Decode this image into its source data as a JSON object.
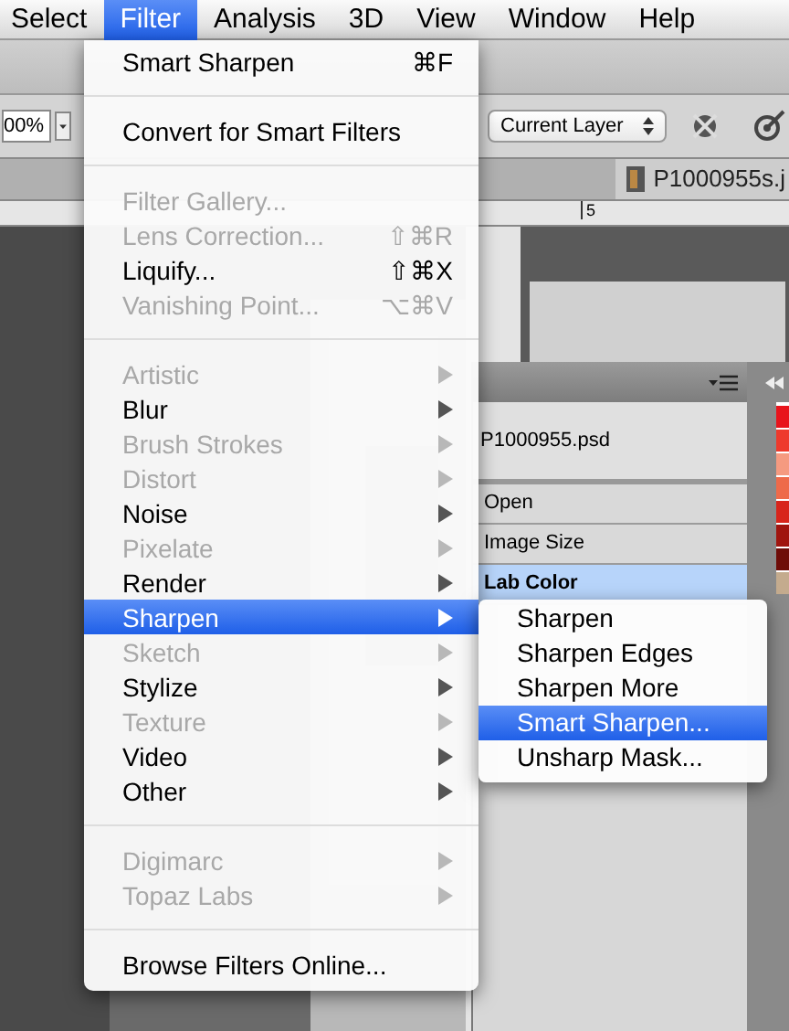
{
  "menubar": [
    {
      "label": "Select",
      "selected": false
    },
    {
      "label": "Filter",
      "selected": true
    },
    {
      "label": "Analysis",
      "selected": false
    },
    {
      "label": "3D",
      "selected": false
    },
    {
      "label": "View",
      "selected": false
    },
    {
      "label": "Window",
      "selected": false
    },
    {
      "label": "Help",
      "selected": false
    }
  ],
  "options_bar": {
    "zoom": "00%",
    "sample": "Current Layer"
  },
  "document_tab": {
    "title": "P1000955s.j"
  },
  "ruler": {
    "label": "5"
  },
  "history_panel": {
    "snapshot": "P1000955.psd",
    "steps": [
      {
        "label": "Open",
        "selected": false
      },
      {
        "label": "Image Size",
        "selected": false
      },
      {
        "label": "Lab Color",
        "selected": true
      }
    ]
  },
  "swatches": [
    {
      "color": "#e8141c"
    },
    {
      "color": "#ee3a2c"
    },
    {
      "color": "#f59a80"
    },
    {
      "color": "#ee6a4a"
    },
    {
      "color": "#d8251b"
    },
    {
      "color": "#a0150f"
    },
    {
      "color": "#6e0c08"
    },
    {
      "color": "#c4ab8e"
    }
  ],
  "filter_menu": {
    "items": [
      {
        "kind": "item",
        "label": "Smart Sharpen",
        "shortcut": "⌘F",
        "disabled": false,
        "selected": false
      },
      {
        "kind": "separator"
      },
      {
        "kind": "item",
        "label": "Convert for Smart Filters",
        "disabled": false,
        "selected": false
      },
      {
        "kind": "separator"
      },
      {
        "kind": "item",
        "label": "Filter Gallery...",
        "disabled": true,
        "selected": false
      },
      {
        "kind": "item",
        "label": "Lens Correction...",
        "shortcut": "⇧⌘R",
        "disabled": true,
        "selected": false
      },
      {
        "kind": "item",
        "label": "Liquify...",
        "shortcut": "⇧⌘X",
        "disabled": false,
        "selected": false
      },
      {
        "kind": "item",
        "label": "Vanishing Point...",
        "shortcut": "⌥⌘V",
        "disabled": true,
        "selected": false
      },
      {
        "kind": "separator"
      },
      {
        "kind": "submenu",
        "label": "Artistic",
        "disabled": true,
        "selected": false
      },
      {
        "kind": "submenu",
        "label": "Blur",
        "disabled": false,
        "selected": false
      },
      {
        "kind": "submenu",
        "label": "Brush Strokes",
        "disabled": true,
        "selected": false
      },
      {
        "kind": "submenu",
        "label": "Distort",
        "disabled": true,
        "selected": false
      },
      {
        "kind": "submenu",
        "label": "Noise",
        "disabled": false,
        "selected": false
      },
      {
        "kind": "submenu",
        "label": "Pixelate",
        "disabled": true,
        "selected": false
      },
      {
        "kind": "submenu",
        "label": "Render",
        "disabled": false,
        "selected": false
      },
      {
        "kind": "submenu",
        "label": "Sharpen",
        "disabled": false,
        "selected": true
      },
      {
        "kind": "submenu",
        "label": "Sketch",
        "disabled": true,
        "selected": false
      },
      {
        "kind": "submenu",
        "label": "Stylize",
        "disabled": false,
        "selected": false
      },
      {
        "kind": "submenu",
        "label": "Texture",
        "disabled": true,
        "selected": false
      },
      {
        "kind": "submenu",
        "label": "Video",
        "disabled": false,
        "selected": false
      },
      {
        "kind": "submenu",
        "label": "Other",
        "disabled": false,
        "selected": false
      },
      {
        "kind": "separator"
      },
      {
        "kind": "submenu",
        "label": "Digimarc",
        "disabled": true,
        "selected": false
      },
      {
        "kind": "submenu",
        "label": "Topaz Labs",
        "disabled": true,
        "selected": false
      },
      {
        "kind": "separator"
      },
      {
        "kind": "item",
        "label": "Browse Filters Online...",
        "disabled": false,
        "selected": false
      }
    ]
  },
  "sharpen_submenu": {
    "items": [
      {
        "label": "Sharpen",
        "selected": false
      },
      {
        "label": "Sharpen Edges",
        "selected": false
      },
      {
        "label": "Sharpen More",
        "selected": false
      },
      {
        "label": "Smart Sharpen...",
        "selected": true
      },
      {
        "label": "Unsharp Mask...",
        "selected": false
      }
    ]
  }
}
